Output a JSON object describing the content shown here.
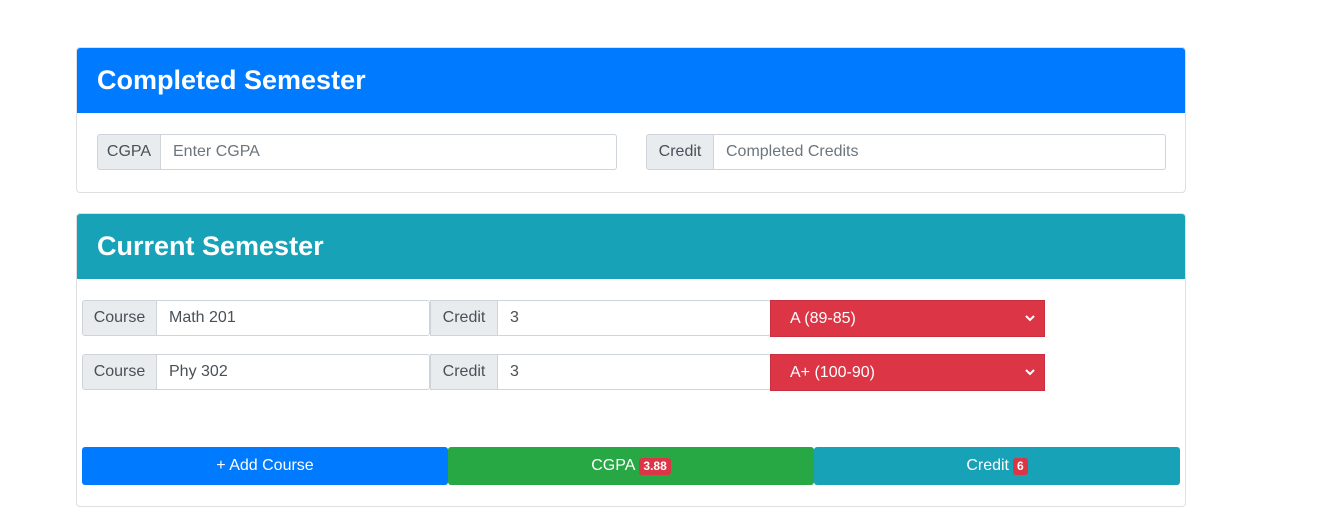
{
  "completed": {
    "title": "Completed Semester",
    "cgpa_label": "CGPA",
    "cgpa_placeholder": "Enter CGPA",
    "credit_label": "Credit",
    "credit_placeholder": "Completed Credits"
  },
  "current": {
    "title": "Current Semester",
    "rows": [
      {
        "course_label": "Course",
        "course_value": "Math 201",
        "credit_label": "Credit",
        "credit_value": "3",
        "grade": "A (89-85)"
      },
      {
        "course_label": "Course",
        "course_value": "Phy 302",
        "credit_label": "Credit",
        "credit_value": "3",
        "grade": "A+ (100-90)"
      }
    ]
  },
  "actions": {
    "add_course": "+ Add Course",
    "cgpa_label": "CGPA",
    "cgpa_value": "3.88",
    "credit_label": "Credit",
    "credit_value": "6"
  },
  "colors": {
    "primary": "#007bff",
    "info": "#17a2b8",
    "success": "#28a745",
    "danger": "#dc3545"
  }
}
